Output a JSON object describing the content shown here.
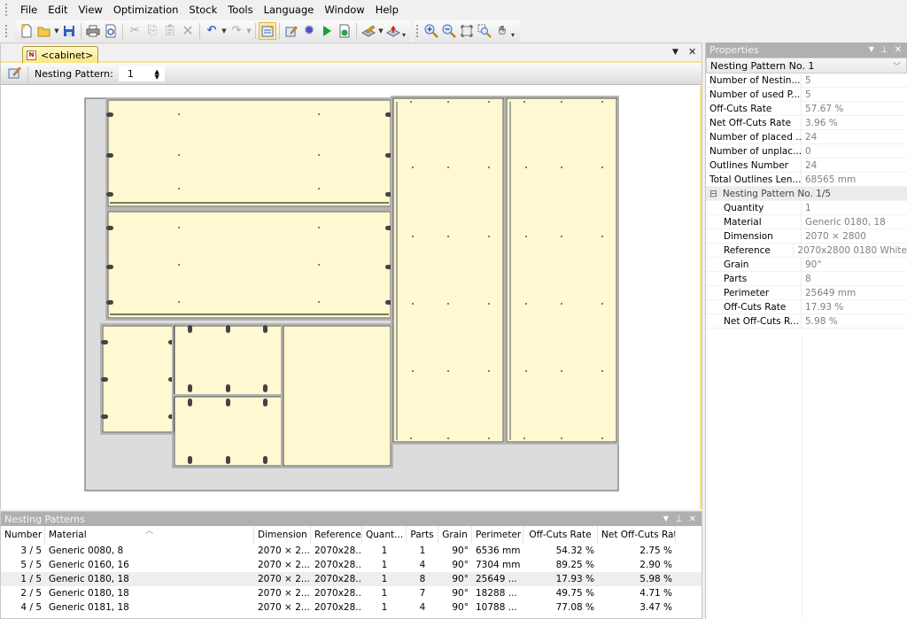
{
  "menu": [
    "File",
    "Edit",
    "View",
    "Optimization",
    "Stock",
    "Tools",
    "Language",
    "Window",
    "Help"
  ],
  "toolbar": {
    "buttons": [
      "new-icon",
      "open-icon",
      "save-icon",
      "print-icon",
      "print-preview-icon",
      "cut-icon",
      "copy-icon",
      "paste-icon",
      "delete-icon",
      "undo-icon",
      "redo-icon",
      "properties-icon",
      "edit-icon",
      "settings-icon",
      "run-icon",
      "export-icon",
      "layers-icon",
      "stock-icon",
      "zoom-in-icon",
      "zoom-out-icon",
      "zoom-extents-icon",
      "zoom-window-icon",
      "pan-icon"
    ]
  },
  "document": {
    "tab_label": "<cabinet>",
    "nesting_pattern_label": "Nesting Pattern:",
    "nesting_pattern_value": "1"
  },
  "properties": {
    "title": "Properties",
    "selector": "Nesting Pattern No. 1",
    "rows": [
      {
        "key": "Number of Nestin...",
        "value": "5"
      },
      {
        "key": "Number of used P...",
        "value": "5"
      },
      {
        "key": "Off-Cuts Rate",
        "value": "57.67 %"
      },
      {
        "key": "Net Off-Cuts Rate",
        "value": "3.96 %"
      },
      {
        "key": "Number of placed ...",
        "value": "24"
      },
      {
        "key": "Number of unplac...",
        "value": "0"
      },
      {
        "key": "Outlines Number",
        "value": "24"
      },
      {
        "key": "Total Outlines Len...",
        "value": "68565 mm"
      }
    ],
    "group": {
      "title": "Nesting Pattern No. 1/5",
      "toggle": "⊟",
      "rows": [
        {
          "key": "Quantity",
          "value": "1"
        },
        {
          "key": "Material",
          "value": "Generic 0180, 18"
        },
        {
          "key": "Dimension",
          "value": "2070 × 2800"
        },
        {
          "key": "Reference",
          "value": "2070x2800 0180 White"
        },
        {
          "key": "Grain",
          "value": "90°"
        },
        {
          "key": "Parts",
          "value": "8"
        },
        {
          "key": "Perimeter",
          "value": "25649 mm"
        },
        {
          "key": "Off-Cuts Rate",
          "value": "17.93 %"
        },
        {
          "key": "Net Off-Cuts R...",
          "value": "5.98 %"
        }
      ]
    }
  },
  "nesting_patterns": {
    "title": "Nesting Patterns",
    "columns": [
      "Number",
      "Material",
      "Dimension",
      "Reference",
      "Quant...",
      "Parts",
      "Grain",
      "Perimeter",
      "Off-Cuts Rate",
      "Net Off-Cuts Rate"
    ],
    "rows": [
      {
        "number": "3 / 5",
        "material": "Generic 0080, 8",
        "dimension": "2070 × 2...",
        "reference": "2070x28...",
        "quantity": "1",
        "parts": "1",
        "grain": "90°",
        "perimeter": "6536 mm",
        "offcuts": "54.32 %",
        "net_offcuts": "2.75 %",
        "selected": false
      },
      {
        "number": "5 / 5",
        "material": "Generic 0160, 16",
        "dimension": "2070 × 2...",
        "reference": "2070x28...",
        "quantity": "1",
        "parts": "4",
        "grain": "90°",
        "perimeter": "7304 mm",
        "offcuts": "89.25 %",
        "net_offcuts": "2.90 %",
        "selected": false
      },
      {
        "number": "1 / 5",
        "material": "Generic 0180, 18",
        "dimension": "2070 × 2...",
        "reference": "2070x28...",
        "quantity": "1",
        "parts": "8",
        "grain": "90°",
        "perimeter": "25649 ...",
        "offcuts": "17.93 %",
        "net_offcuts": "5.98 %",
        "selected": true
      },
      {
        "number": "2 / 5",
        "material": "Generic 0180, 18",
        "dimension": "2070 × 2...",
        "reference": "2070x28...",
        "quantity": "1",
        "parts": "7",
        "grain": "90°",
        "perimeter": "18288 ...",
        "offcuts": "49.75 %",
        "net_offcuts": "4.71 %",
        "selected": false
      },
      {
        "number": "4 / 5",
        "material": "Generic 0181, 18",
        "dimension": "2070 × 2...",
        "reference": "2070x28...",
        "quantity": "1",
        "parts": "4",
        "grain": "90°",
        "perimeter": "10788 ...",
        "offcuts": "77.08 %",
        "net_offcuts": "3.47 %",
        "selected": false
      }
    ]
  },
  "colors": {
    "part_fill": "#fff8d0",
    "sheet_fill": "#dcdcdc",
    "tab_active": "#fae782",
    "panel_title": "#b0b0b0"
  }
}
